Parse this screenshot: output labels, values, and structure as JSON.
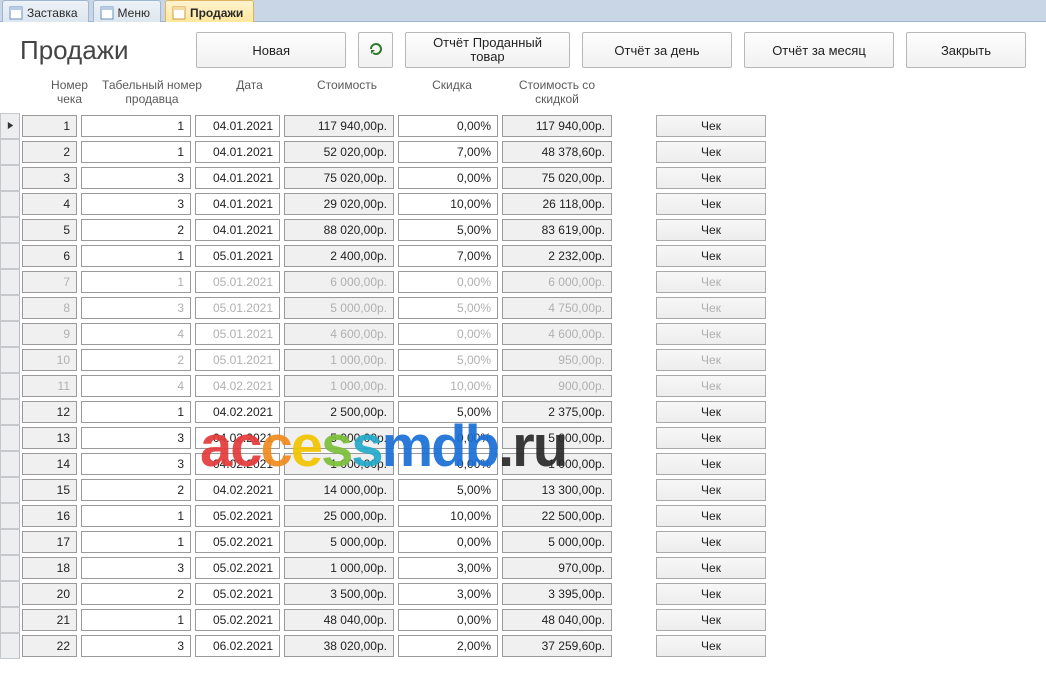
{
  "tabs": [
    {
      "label": "Заставка",
      "active": false
    },
    {
      "label": "Меню",
      "active": false
    },
    {
      "label": "Продажи",
      "active": true
    }
  ],
  "title": "Продажи",
  "toolbar": {
    "new": "Новая",
    "refresh_icon": "refresh-icon",
    "report_product": "Отчёт Проданный товар",
    "report_day": "Отчёт за день",
    "report_month": "Отчёт за месяц",
    "close": "Закрыть"
  },
  "columns": {
    "num": "Номер чека",
    "seller": "Табельный номер продавца",
    "date": "Дата",
    "cost": "Стоимость",
    "discount": "Скидка",
    "total": "Стоимость со скидкой"
  },
  "row_button_label": "Чек",
  "watermark": "accessmdb.ru",
  "rows": [
    {
      "num": "1",
      "seller": "1",
      "date": "04.01.2021",
      "cost": "117 940,00р.",
      "discount": "0,00%",
      "total": "117 940,00р.",
      "current": true
    },
    {
      "num": "2",
      "seller": "1",
      "date": "04.01.2021",
      "cost": "52 020,00р.",
      "discount": "7,00%",
      "total": "48 378,60р."
    },
    {
      "num": "3",
      "seller": "3",
      "date": "04.01.2021",
      "cost": "75 020,00р.",
      "discount": "0,00%",
      "total": "75 020,00р."
    },
    {
      "num": "4",
      "seller": "3",
      "date": "04.01.2021",
      "cost": "29 020,00р.",
      "discount": "10,00%",
      "total": "26 118,00р."
    },
    {
      "num": "5",
      "seller": "2",
      "date": "04.01.2021",
      "cost": "88 020,00р.",
      "discount": "5,00%",
      "total": "83 619,00р."
    },
    {
      "num": "6",
      "seller": "1",
      "date": "05.01.2021",
      "cost": "2 400,00р.",
      "discount": "7,00%",
      "total": "2 232,00р."
    },
    {
      "num": "7",
      "seller": "1",
      "date": "05.01.2021",
      "cost": "6 000,00р.",
      "discount": "0,00%",
      "total": "6 000,00р.",
      "faded": true
    },
    {
      "num": "8",
      "seller": "3",
      "date": "05.01.2021",
      "cost": "5 000,00р.",
      "discount": "5,00%",
      "total": "4 750,00р.",
      "faded": true
    },
    {
      "num": "9",
      "seller": "4",
      "date": "05.01.2021",
      "cost": "4 600,00р.",
      "discount": "0,00%",
      "total": "4 600,00р.",
      "faded": true
    },
    {
      "num": "10",
      "seller": "2",
      "date": "05.01.2021",
      "cost": "1 000,00р.",
      "discount": "5,00%",
      "total": "950,00р.",
      "faded": true
    },
    {
      "num": "11",
      "seller": "4",
      "date": "04.02.2021",
      "cost": "1 000,00р.",
      "discount": "10,00%",
      "total": "900,00р.",
      "faded": true
    },
    {
      "num": "12",
      "seller": "1",
      "date": "04.02.2021",
      "cost": "2 500,00р.",
      "discount": "5,00%",
      "total": "2 375,00р."
    },
    {
      "num": "13",
      "seller": "3",
      "date": "04.02.2021",
      "cost": "5 000,00р.",
      "discount": "0,00%",
      "total": "5 000,00р."
    },
    {
      "num": "14",
      "seller": "3",
      "date": "04.02.2021",
      "cost": "1 000,00р.",
      "discount": "0,00%",
      "total": "1 000,00р."
    },
    {
      "num": "15",
      "seller": "2",
      "date": "04.02.2021",
      "cost": "14 000,00р.",
      "discount": "5,00%",
      "total": "13 300,00р."
    },
    {
      "num": "16",
      "seller": "1",
      "date": "05.02.2021",
      "cost": "25 000,00р.",
      "discount": "10,00%",
      "total": "22 500,00р."
    },
    {
      "num": "17",
      "seller": "1",
      "date": "05.02.2021",
      "cost": "5 000,00р.",
      "discount": "0,00%",
      "total": "5 000,00р."
    },
    {
      "num": "18",
      "seller": "3",
      "date": "05.02.2021",
      "cost": "1 000,00р.",
      "discount": "3,00%",
      "total": "970,00р."
    },
    {
      "num": "20",
      "seller": "2",
      "date": "05.02.2021",
      "cost": "3 500,00р.",
      "discount": "3,00%",
      "total": "3 395,00р."
    },
    {
      "num": "21",
      "seller": "1",
      "date": "05.02.2021",
      "cost": "48 040,00р.",
      "discount": "0,00%",
      "total": "48 040,00р."
    },
    {
      "num": "22",
      "seller": "3",
      "date": "06.02.2021",
      "cost": "38 020,00р.",
      "discount": "2,00%",
      "total": "37 259,60р."
    }
  ]
}
